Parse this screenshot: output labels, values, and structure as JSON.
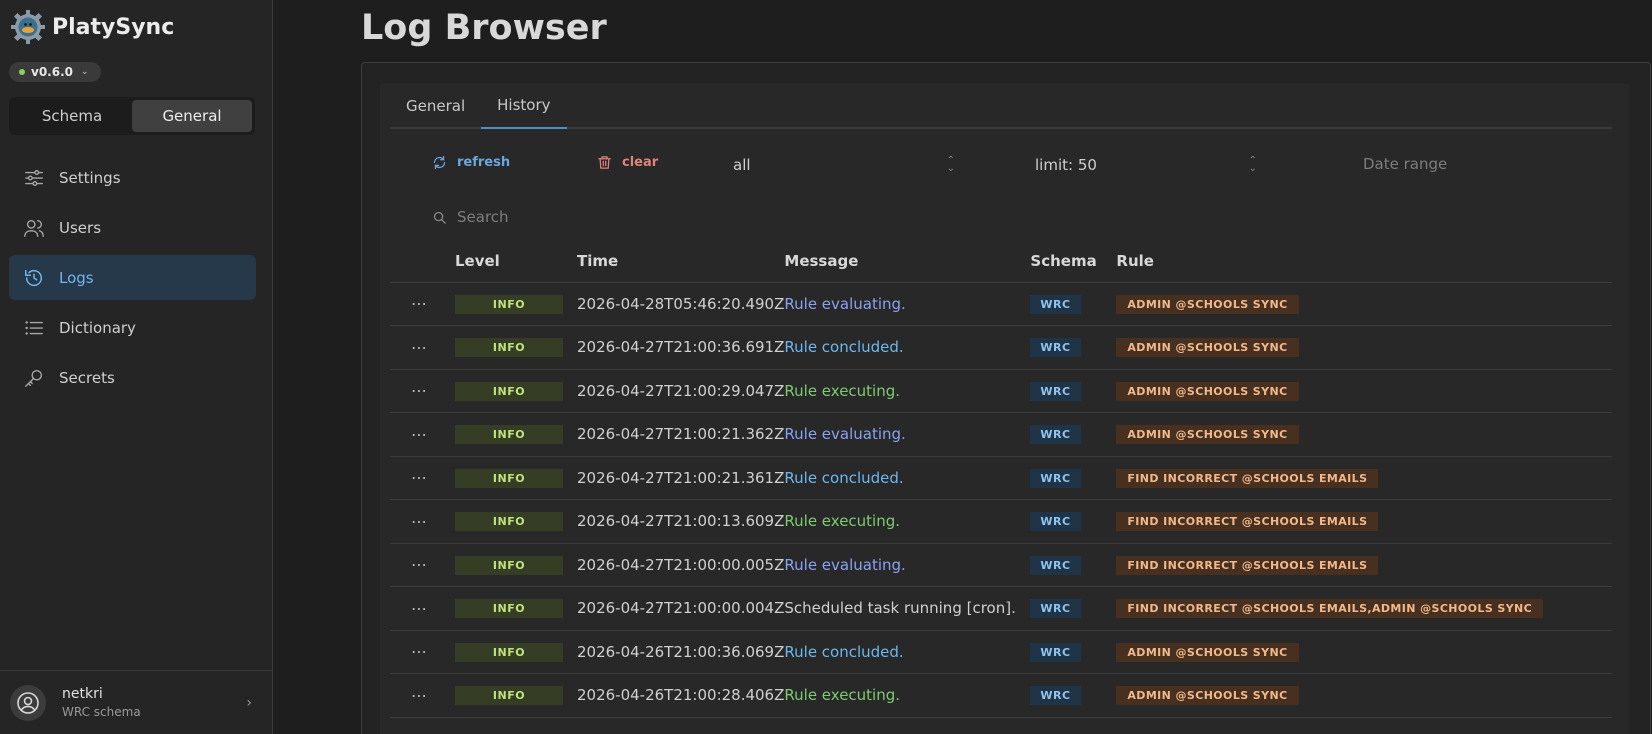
{
  "app": {
    "name": "PlatySync",
    "version": "v0.6.0",
    "segments": [
      {
        "label": "Schema"
      },
      {
        "label": "General"
      }
    ],
    "nav": [
      {
        "label": "Settings",
        "icon": "sliders-icon"
      },
      {
        "label": "Users",
        "icon": "users-icon"
      },
      {
        "label": "Logs",
        "icon": "history-icon"
      },
      {
        "label": "Dictionary",
        "icon": "list-icon"
      },
      {
        "label": "Secrets",
        "icon": "key-icon"
      }
    ],
    "user": {
      "name": "netkri",
      "subtitle": "WRC schema"
    }
  },
  "page": {
    "title": "Log Browser",
    "tabs": [
      {
        "label": "General"
      },
      {
        "label": "History"
      }
    ],
    "toolbar": {
      "refresh_label": "refresh",
      "clear_label": "clear",
      "level_value": "all",
      "limit_value": "limit: 50",
      "date_range_placeholder": "Date range"
    },
    "search": {
      "placeholder": "Search"
    },
    "table": {
      "columns": [
        "Level",
        "Time",
        "Message",
        "Schema",
        "Rule"
      ],
      "rows": [
        {
          "level": "INFO",
          "time": "2026-04-28T05:46:20.490Z",
          "message": "Rule evaluating.",
          "kind": "evaluating",
          "schema": "WRC",
          "rule": "ADMIN @SCHOOLS SYNC"
        },
        {
          "level": "INFO",
          "time": "2026-04-27T21:00:36.691Z",
          "message": "Rule concluded.",
          "kind": "concluded",
          "schema": "WRC",
          "rule": "ADMIN @SCHOOLS SYNC"
        },
        {
          "level": "INFO",
          "time": "2026-04-27T21:00:29.047Z",
          "message": "Rule executing.",
          "kind": "executing",
          "schema": "WRC",
          "rule": "ADMIN @SCHOOLS SYNC"
        },
        {
          "level": "INFO",
          "time": "2026-04-27T21:00:21.362Z",
          "message": "Rule evaluating.",
          "kind": "evaluating",
          "schema": "WRC",
          "rule": "ADMIN @SCHOOLS SYNC"
        },
        {
          "level": "INFO",
          "time": "2026-04-27T21:00:21.361Z",
          "message": "Rule concluded.",
          "kind": "concluded",
          "schema": "WRC",
          "rule": "FIND INCORRECT @SCHOOLS EMAILS"
        },
        {
          "level": "INFO",
          "time": "2026-04-27T21:00:13.609Z",
          "message": "Rule executing.",
          "kind": "executing",
          "schema": "WRC",
          "rule": "FIND INCORRECT @SCHOOLS EMAILS"
        },
        {
          "level": "INFO",
          "time": "2026-04-27T21:00:00.005Z",
          "message": "Rule evaluating.",
          "kind": "evaluating",
          "schema": "WRC",
          "rule": "FIND INCORRECT @SCHOOLS EMAILS"
        },
        {
          "level": "INFO",
          "time": "2026-04-27T21:00:00.004Z",
          "message": "Scheduled task running [cron].",
          "kind": "plain",
          "schema": "WRC",
          "rule": "FIND INCORRECT @SCHOOLS EMAILS,ADMIN @SCHOOLS SYNC"
        },
        {
          "level": "INFO",
          "time": "2026-04-26T21:00:36.069Z",
          "message": "Rule concluded.",
          "kind": "concluded",
          "schema": "WRC",
          "rule": "ADMIN @SCHOOLS SYNC"
        },
        {
          "level": "INFO",
          "time": "2026-04-26T21:00:28.406Z",
          "message": "Rule executing.",
          "kind": "executing",
          "schema": "WRC",
          "rule": "ADMIN @SCHOOLS SYNC"
        }
      ]
    }
  },
  "colors": {
    "accent": "#6fb6ea",
    "refresh": "#6aa7df",
    "clear": "#e0837c",
    "level_badge": "#bfe27d",
    "schema_badge": "#8fc4ee",
    "rule_badge": "#f1b98b"
  }
}
